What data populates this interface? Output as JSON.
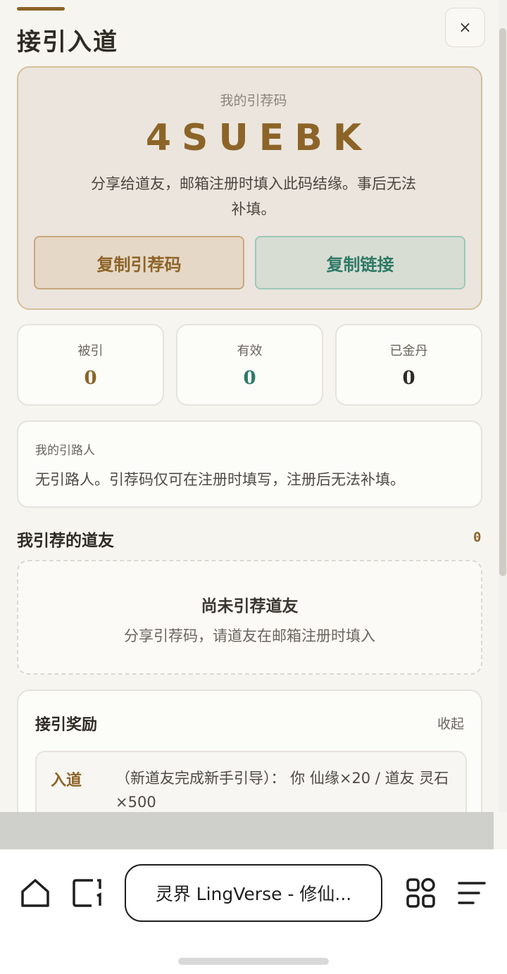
{
  "header": {
    "title": "接引入道",
    "close_label": "×"
  },
  "code_card": {
    "label": "我的引荐码",
    "code": "4SUEBK",
    "description": "分享给道友，邮箱注册时填入此码结缘。事后无法补填。",
    "copy_code_label": "复制引荐码",
    "copy_link_label": "复制链接"
  },
  "stats": [
    {
      "label": "被引",
      "value": "0",
      "color": "#8c6428"
    },
    {
      "label": "有效",
      "value": "0",
      "color": "#2e7a66"
    },
    {
      "label": "已金丹",
      "value": "0",
      "color": "#2e2a24"
    }
  ],
  "referrer": {
    "title": "我的引路人",
    "text": "无引路人。引荐码仅可在注册时填写，注册后无法补填。"
  },
  "referred": {
    "title": "我引荐的道友",
    "count": "0",
    "empty_title": "尚未引荐道友",
    "empty_desc": "分享引荐码，请道友在邮箱注册时填入"
  },
  "rewards": {
    "title": "接引奖励",
    "collapse_label": "收起",
    "items": [
      {
        "tag": "入道",
        "text": "（新道友完成新手引导）： 你 仙缘×20 / 道友 灵石×500"
      }
    ]
  },
  "browser": {
    "url_title": "灵界 LingVerse - 修仙...",
    "icons": [
      "home-icon",
      "tabs-icon",
      "apps-grid-icon",
      "menu-icon"
    ]
  },
  "colors": {
    "accent": "#8c6428",
    "teal": "#2e7a66",
    "background": "#f6f5f0"
  }
}
